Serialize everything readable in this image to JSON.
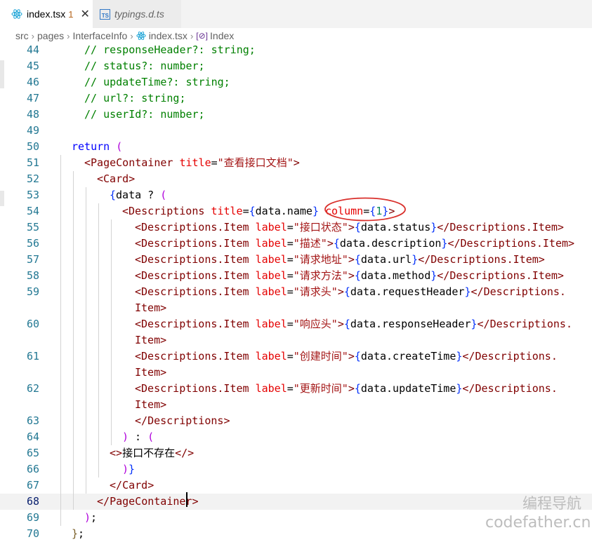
{
  "tabs": [
    {
      "name": "index.tsx",
      "problems": "1",
      "icon": "react-icon",
      "active": true
    },
    {
      "name": "typings.d.ts",
      "icon": "typescript-icon",
      "active": false
    }
  ],
  "close_glyph": "✕",
  "breadcrumb": {
    "items": [
      "src",
      "pages",
      "InterfaceInfo",
      "index.tsx",
      "Index"
    ],
    "separator": "›",
    "symbol_glyph": "[⊘]"
  },
  "editor": {
    "current_line": "68",
    "lines": [
      {
        "n": "44",
        "tokens": [
          [
            "c",
            "// responseHeader?: string;"
          ]
        ]
      },
      {
        "n": "45",
        "tokens": [
          [
            "c",
            "// status?: number;"
          ]
        ]
      },
      {
        "n": "46",
        "tokens": [
          [
            "c",
            "// updateTime?: string;"
          ]
        ]
      },
      {
        "n": "47",
        "tokens": [
          [
            "c",
            "// url?: string;"
          ]
        ]
      },
      {
        "n": "48",
        "tokens": [
          [
            "c",
            "// userId?: number;"
          ]
        ]
      },
      {
        "n": "49",
        "tokens": []
      },
      {
        "n": "50",
        "tokens": [
          [
            "k",
            "return"
          ],
          [
            "t",
            " "
          ],
          [
            "b2",
            "("
          ]
        ]
      },
      {
        "n": "51",
        "tokens": [
          [
            "p",
            "<"
          ],
          [
            "g",
            "PageContainer"
          ],
          [
            "t",
            " "
          ],
          [
            "a",
            "title"
          ],
          [
            "t",
            "="
          ],
          [
            "s",
            "\"查看接口文档\""
          ],
          [
            "p",
            ">"
          ]
        ]
      },
      {
        "n": "52",
        "tokens": [
          [
            "p",
            "<"
          ],
          [
            "g",
            "Card"
          ],
          [
            "p",
            ">"
          ]
        ]
      },
      {
        "n": "53",
        "tokens": [
          [
            "b",
            "{"
          ],
          [
            "t",
            "data ? "
          ],
          [
            "b2",
            "("
          ]
        ]
      },
      {
        "n": "54",
        "tokens": [
          [
            "p",
            "<"
          ],
          [
            "g",
            "Descriptions"
          ],
          [
            "t",
            " "
          ],
          [
            "a",
            "title"
          ],
          [
            "t",
            "="
          ],
          [
            "b",
            "{"
          ],
          [
            "t",
            "data.name"
          ],
          [
            "b",
            "}"
          ],
          [
            "t",
            " "
          ],
          [
            "a",
            "column"
          ],
          [
            "t",
            "="
          ],
          [
            "b",
            "{"
          ],
          [
            "n",
            "1"
          ],
          [
            "b",
            "}"
          ],
          [
            "p",
            ">"
          ]
        ]
      },
      {
        "n": "55",
        "tokens": [
          [
            "p",
            "<"
          ],
          [
            "g",
            "Descriptions.Item"
          ],
          [
            "t",
            " "
          ],
          [
            "a",
            "label"
          ],
          [
            "t",
            "="
          ],
          [
            "s",
            "\"接口状态\""
          ],
          [
            "p",
            ">"
          ],
          [
            "b",
            "{"
          ],
          [
            "t",
            "data.status"
          ],
          [
            "b",
            "}"
          ],
          [
            "p",
            "</"
          ],
          [
            "g",
            "Descriptions.Item"
          ],
          [
            "p",
            ">"
          ]
        ]
      },
      {
        "n": "56",
        "tokens": [
          [
            "p",
            "<"
          ],
          [
            "g",
            "Descriptions.Item"
          ],
          [
            "t",
            " "
          ],
          [
            "a",
            "label"
          ],
          [
            "t",
            "="
          ],
          [
            "s",
            "\"描述\""
          ],
          [
            "p",
            ">"
          ],
          [
            "b",
            "{"
          ],
          [
            "t",
            "data.description"
          ],
          [
            "b",
            "}"
          ],
          [
            "p",
            "</"
          ],
          [
            "g",
            "Descriptions.Item"
          ],
          [
            "p",
            ">"
          ]
        ]
      },
      {
        "n": "57",
        "tokens": [
          [
            "p",
            "<"
          ],
          [
            "g",
            "Descriptions.Item"
          ],
          [
            "t",
            " "
          ],
          [
            "a",
            "label"
          ],
          [
            "t",
            "="
          ],
          [
            "s",
            "\"请求地址\""
          ],
          [
            "p",
            ">"
          ],
          [
            "b",
            "{"
          ],
          [
            "t",
            "data.url"
          ],
          [
            "b",
            "}"
          ],
          [
            "p",
            "</"
          ],
          [
            "g",
            "Descriptions.Item"
          ],
          [
            "p",
            ">"
          ]
        ]
      },
      {
        "n": "58",
        "tokens": [
          [
            "p",
            "<"
          ],
          [
            "g",
            "Descriptions.Item"
          ],
          [
            "t",
            " "
          ],
          [
            "a",
            "label"
          ],
          [
            "t",
            "="
          ],
          [
            "s",
            "\"请求方法\""
          ],
          [
            "p",
            ">"
          ],
          [
            "b",
            "{"
          ],
          [
            "t",
            "data.method"
          ],
          [
            "b",
            "}"
          ],
          [
            "p",
            "</"
          ],
          [
            "g",
            "Descriptions.Item"
          ],
          [
            "p",
            ">"
          ]
        ]
      },
      {
        "n": "59",
        "tokens": [
          [
            "p",
            "<"
          ],
          [
            "g",
            "Descriptions.Item"
          ],
          [
            "t",
            " "
          ],
          [
            "a",
            "label"
          ],
          [
            "t",
            "="
          ],
          [
            "s",
            "\"请求头\""
          ],
          [
            "p",
            ">"
          ],
          [
            "b",
            "{"
          ],
          [
            "t",
            "data.requestHeader"
          ],
          [
            "b",
            "}"
          ],
          [
            "p",
            "</"
          ],
          [
            "g",
            "Descriptions."
          ]
        ]
      },
      {
        "n": "",
        "tokens": [
          [
            "g",
            "Item"
          ],
          [
            "p",
            ">"
          ]
        ]
      },
      {
        "n": "60",
        "tokens": [
          [
            "p",
            "<"
          ],
          [
            "g",
            "Descriptions.Item"
          ],
          [
            "t",
            " "
          ],
          [
            "a",
            "label"
          ],
          [
            "t",
            "="
          ],
          [
            "s",
            "\"响应头\""
          ],
          [
            "p",
            ">"
          ],
          [
            "b",
            "{"
          ],
          [
            "t",
            "data.responseHeader"
          ],
          [
            "b",
            "}"
          ],
          [
            "p",
            "</"
          ],
          [
            "g",
            "Descriptions."
          ]
        ]
      },
      {
        "n": "",
        "tokens": [
          [
            "g",
            "Item"
          ],
          [
            "p",
            ">"
          ]
        ]
      },
      {
        "n": "61",
        "tokens": [
          [
            "p",
            "<"
          ],
          [
            "g",
            "Descriptions.Item"
          ],
          [
            "t",
            " "
          ],
          [
            "a",
            "label"
          ],
          [
            "t",
            "="
          ],
          [
            "s",
            "\"创建时间\""
          ],
          [
            "p",
            ">"
          ],
          [
            "b",
            "{"
          ],
          [
            "t",
            "data.createTime"
          ],
          [
            "b",
            "}"
          ],
          [
            "p",
            "</"
          ],
          [
            "g",
            "Descriptions."
          ]
        ]
      },
      {
        "n": "",
        "tokens": [
          [
            "g",
            "Item"
          ],
          [
            "p",
            ">"
          ]
        ]
      },
      {
        "n": "62",
        "tokens": [
          [
            "p",
            "<"
          ],
          [
            "g",
            "Descriptions.Item"
          ],
          [
            "t",
            " "
          ],
          [
            "a",
            "label"
          ],
          [
            "t",
            "="
          ],
          [
            "s",
            "\"更新时间\""
          ],
          [
            "p",
            ">"
          ],
          [
            "b",
            "{"
          ],
          [
            "t",
            "data.updateTime"
          ],
          [
            "b",
            "}"
          ],
          [
            "p",
            "</"
          ],
          [
            "g",
            "Descriptions."
          ]
        ]
      },
      {
        "n": "",
        "tokens": [
          [
            "g",
            "Item"
          ],
          [
            "p",
            ">"
          ]
        ]
      },
      {
        "n": "63",
        "tokens": [
          [
            "p",
            "</"
          ],
          [
            "g",
            "Descriptions"
          ],
          [
            "p",
            ">"
          ]
        ]
      },
      {
        "n": "64",
        "tokens": [
          [
            "b2",
            ")"
          ],
          [
            "t",
            " : "
          ],
          [
            "b2",
            "("
          ]
        ]
      },
      {
        "n": "65",
        "tokens": [
          [
            "p",
            "<>"
          ],
          [
            "t",
            "接口不存在"
          ],
          [
            "p",
            "</>"
          ]
        ]
      },
      {
        "n": "66",
        "tokens": [
          [
            "b2",
            ")"
          ],
          [
            "b",
            "}"
          ]
        ]
      },
      {
        "n": "67",
        "tokens": [
          [
            "p",
            "</"
          ],
          [
            "g",
            "Card"
          ],
          [
            "p",
            ">"
          ]
        ]
      },
      {
        "n": "68",
        "tokens": [
          [
            "p",
            "</"
          ],
          [
            "g",
            "PageContainer"
          ],
          [
            "p",
            ">"
          ]
        ]
      },
      {
        "n": "69",
        "tokens": [
          [
            "b2",
            ")"
          ],
          [
            "t",
            ";"
          ]
        ]
      },
      {
        "n": "70",
        "tokens": [
          [
            "b3",
            "}"
          ],
          [
            "t",
            ";"
          ]
        ]
      }
    ]
  },
  "watermark": {
    "line1": "编程导航",
    "line2": "codefather.cn"
  },
  "colors": {
    "annotation": "#d9302c",
    "active_tab_bg": "#ffffff",
    "tabbar_bg": "#f3f3f3"
  }
}
